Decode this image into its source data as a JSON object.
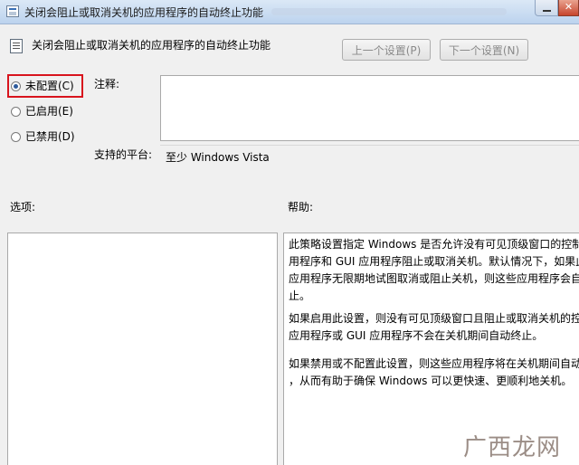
{
  "window": {
    "title": "关闭会阻止或取消关机的应用程序的自动终止功能",
    "close_glyph": "✕"
  },
  "header": {
    "policy_title": "关闭会阻止或取消关机的应用程序的自动终止功能",
    "prev_button": "上一个设置(P)",
    "next_button": "下一个设置(N)"
  },
  "state": {
    "options": [
      {
        "label": "未配置(C)",
        "selected": true
      },
      {
        "label": "已启用(E)",
        "selected": false
      },
      {
        "label": "已禁用(D)",
        "selected": false
      }
    ]
  },
  "comment": {
    "label": "注释:",
    "value": ""
  },
  "platform": {
    "label": "支持的平台:",
    "value": "至少 Windows Vista"
  },
  "options_section": {
    "label": "选项:"
  },
  "help_section": {
    "label": "帮助:",
    "paragraphs": [
      [
        "此策略设置指定 Windows 是否允许没有可见顶级窗口的控制",
        "用程序和 GUI 应用程序阻止或取消关机。默认情况下，如果此",
        "应用程序无限期地试图取消或阻止关机，则这些应用程序会自",
        "止。"
      ],
      [
        "如果启用此设置，则没有可见顶级窗口且阻止或取消关机的控",
        "应用程序或 GUI 应用程序不会在关机期间自动终止。"
      ],
      [
        "如果禁用或不配置此设置，则这些应用程序将在关机期间自动",
        "，从而有助于确保 Windows 可以更快速、更顺利地关机。"
      ]
    ]
  },
  "watermark": "广西龙网",
  "colors": {
    "highlight_box": "#d8141d",
    "title_bar": "#bcd3ee"
  }
}
